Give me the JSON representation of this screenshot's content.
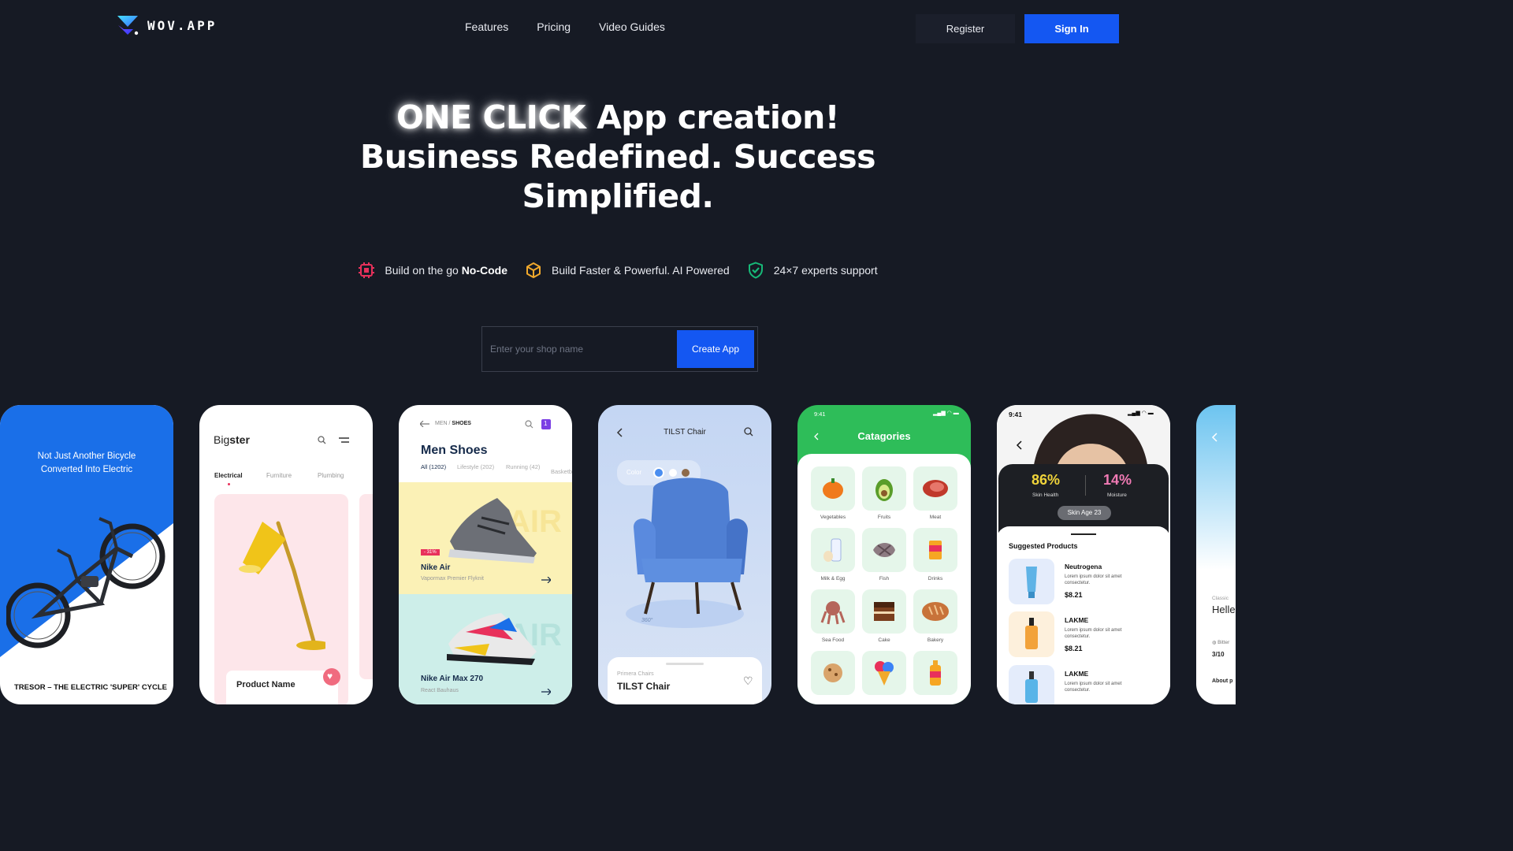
{
  "nav": {
    "logo_text": "WOV.APP",
    "links": [
      "Features",
      "Pricing",
      "Video Guides"
    ],
    "register_label": "Register",
    "signin_label": "Sign In"
  },
  "hero": {
    "highlight": "ONE CLICK",
    "line1_rest": " App creation!",
    "line2": "Business Redefined. Success",
    "line3": "Simplified."
  },
  "features": [
    {
      "icon": "chip-icon",
      "text": "Build on the go ",
      "strong": "No-Code",
      "color": "#e8315b"
    },
    {
      "icon": "cube-icon",
      "text": "Build Faster & Powerful. AI Powered",
      "strong": "",
      "color": "#f1a92c"
    },
    {
      "icon": "shield-check-icon",
      "text": "24×7 experts support",
      "strong": "",
      "color": "#17b978"
    }
  ],
  "shop_form": {
    "placeholder": "Enter your shop name",
    "button_label": "Create App"
  },
  "colors": {
    "background": "#161a24",
    "accent": "#1457f2"
  },
  "phones": {
    "bike": {
      "headline_1": "Not Just Another Bicycle",
      "headline_2": "Converted Into Electric",
      "footer": "TRESOR – THE ELECTRIC 'SUPER' CYCLE"
    },
    "bigster": {
      "logo_light": "Big",
      "logo_bold": "ster",
      "tabs": [
        "Electrical",
        "Furniture",
        "Plumbing"
      ],
      "product_name": "Product Name"
    },
    "shoes": {
      "breadcrumb": "MEN / SHOES",
      "breadcrumb_a": "MEN",
      "breadcrumb_b": "SHOES",
      "badge_count": "1",
      "title": "Men Shoes",
      "filters": [
        "All (1202)",
        "Lifestyle (202)",
        "Running (42)",
        "Basketball"
      ],
      "card1_discount": "- 31%",
      "card1_name": "Nike Air",
      "card1_sub": "Vapormax Premier Flyknit",
      "card1_watermark": "AIR",
      "card2_name": "Nike Air Max 270",
      "card2_sub": "React Bauhaus",
      "card2_watermark": "AIR"
    },
    "chair": {
      "title": "TILST Chair",
      "color_label": "Color",
      "rotate_label": "360°",
      "sheet_category": "Primera Chairs",
      "sheet_name": "TILST Chair"
    },
    "grocery": {
      "time": "9:41",
      "title": "Catagories",
      "categories": [
        "Vegetables",
        "Fruits",
        "Meat",
        "Milk & Egg",
        "Fish",
        "Drinks",
        "Sea Food",
        "Cake",
        "Bakery"
      ]
    },
    "skin": {
      "time": "9:41",
      "stat1_value": "86%",
      "stat1_label": "Skin Health",
      "stat2_value": "14%",
      "stat2_label": "Moisture",
      "skin_age": "Skin Age 23",
      "section_title": "Suggested Products",
      "products": [
        {
          "name": "Neutrogena",
          "desc1": "Lorem ipsum dolor sit amet",
          "desc2": "consectetur.",
          "price": "$8.21"
        },
        {
          "name": "LAKME",
          "desc1": "Lorem ipsum dolor sit amet",
          "desc2": "consectetur.",
          "price": "$8.21"
        },
        {
          "name": "LAKME",
          "desc1": "Lorem ipsum dolor sit amet",
          "desc2": "consectetur.",
          "price": ""
        }
      ]
    },
    "partial": {
      "label": "Classic",
      "title": "Helle",
      "sub": "Bitter",
      "count": "3/10",
      "about": "About p"
    }
  }
}
